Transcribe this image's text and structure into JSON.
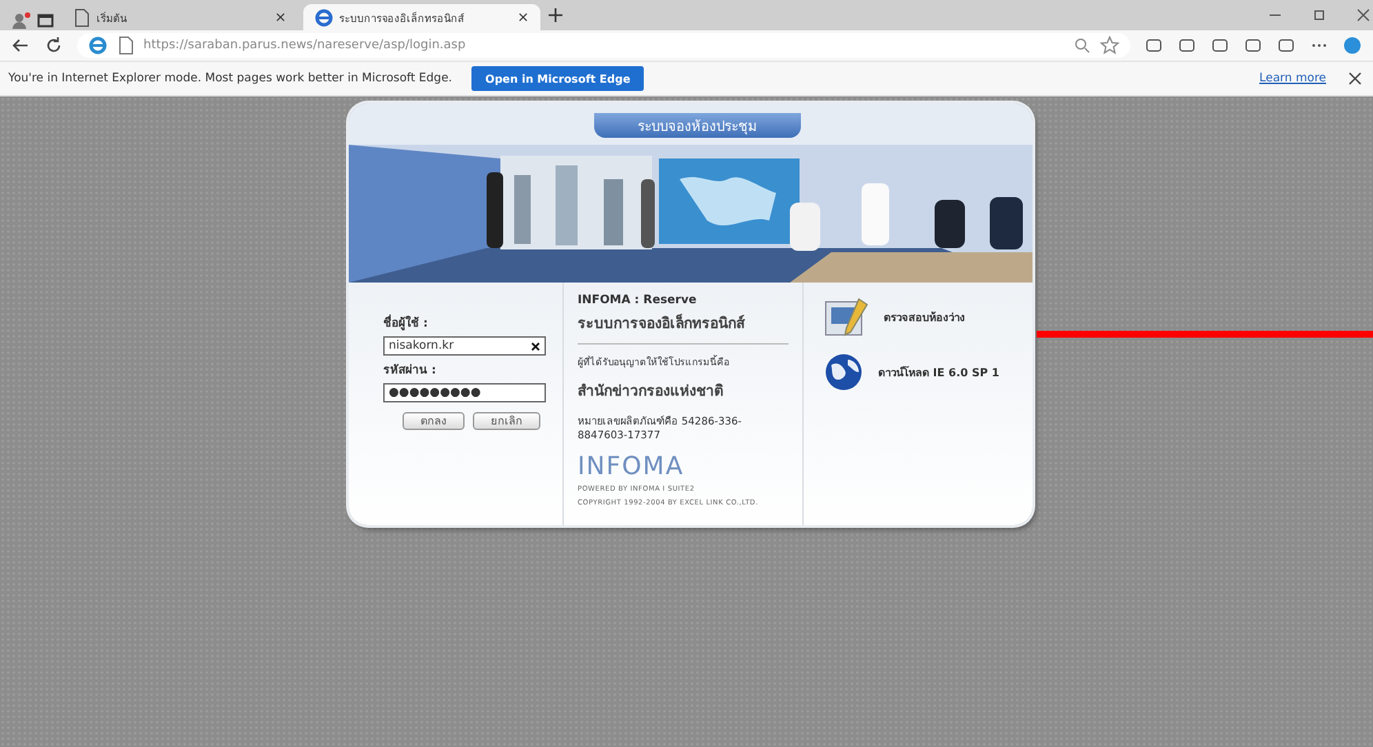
{
  "browser": {
    "tabs": [
      {
        "label": "เริ่มต้น",
        "selected": false
      },
      {
        "label": "ระบบการจองอิเล็กทรอนิกส์",
        "selected": true
      }
    ],
    "address": "https://saraban.parus.news/nareserve/asp/login.asp",
    "infobar": {
      "message": "You're in Internet Explorer mode. Most pages work better in Microsoft Edge.",
      "button": "Open in Microsoft Edge",
      "link": "Learn more"
    }
  },
  "login": {
    "header": "ระบบจองห้องประชุม",
    "username_label": "ชื่อผู้ใช้ :",
    "username": "nisakorn.kr",
    "password_label": "รหัสผ่าน :",
    "password": "●●●●●●●●●",
    "buttons": [
      "ตกลง",
      "ยกเลิก"
    ],
    "product": "INFOMA : Reserve",
    "system": "ระบบการจองอิเล็กทรอนิกส์",
    "licensed_to": "ผู้ที่ได้รับอนุญาตให้ใช้โปรแกรมนี้คือ",
    "organization": "สำนักข่าวกรองแห่งชาติ",
    "serial": "หมายเลขผลิตภัณฑ์คือ 54286-336-8847603-17377",
    "logo": "INFOMA",
    "powered": "POWERED BY INFOMA I SUITE2",
    "copyright": "COPYRIGHT 1992-2004 BY EXCEL LINK CO.,LTD.",
    "links": [
      {
        "kind": "book",
        "label": "ตรวจสอบห้องว่าง"
      },
      {
        "kind": "globe",
        "label": "ดาวน์โหลด IE 6.0 SP 1"
      }
    ]
  }
}
